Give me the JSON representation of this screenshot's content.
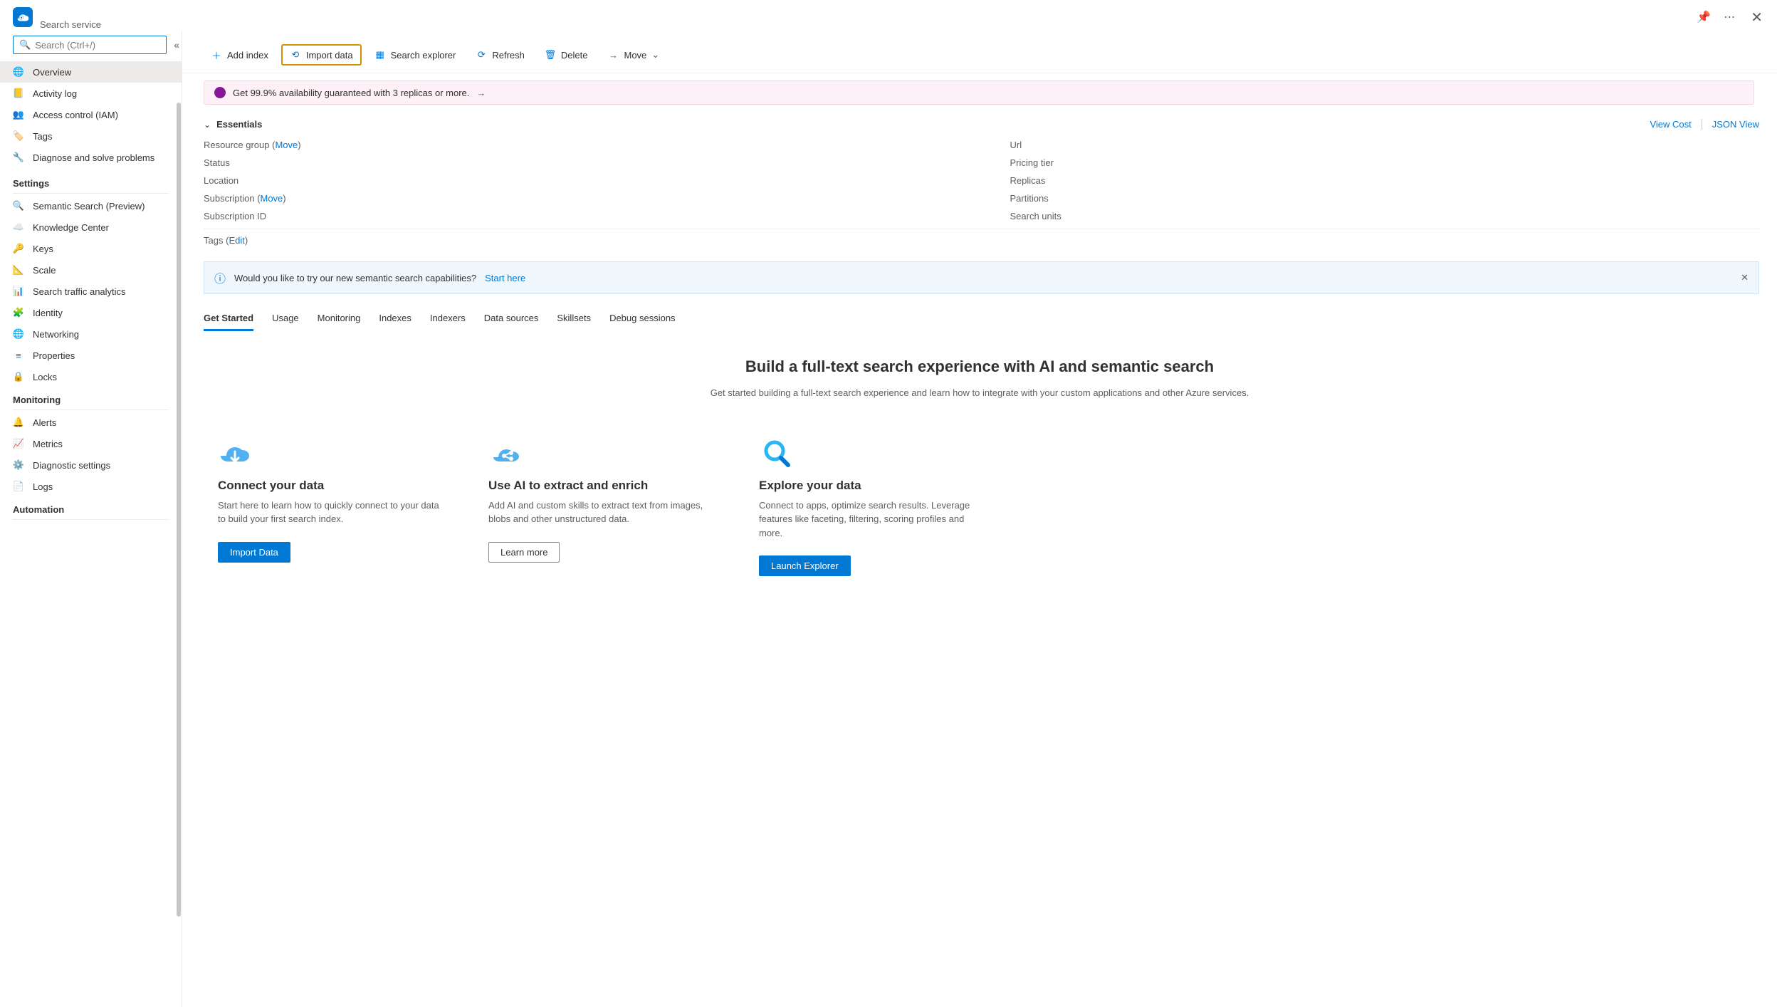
{
  "header": {
    "subtitle": "Search service",
    "pin_tooltip": "Pin",
    "more_tooltip": "More"
  },
  "sidebar": {
    "search_placeholder": "Search (Ctrl+/)",
    "top_items": [
      {
        "label": "Overview",
        "icon": "globe"
      },
      {
        "label": "Activity log",
        "icon": "log"
      },
      {
        "label": "Access control (IAM)",
        "icon": "people"
      },
      {
        "label": "Tags",
        "icon": "tag"
      },
      {
        "label": "Diagnose and solve problems",
        "icon": "wrench"
      }
    ],
    "sections": [
      {
        "title": "Settings",
        "items": [
          {
            "label": "Semantic Search (Preview)",
            "icon": "search"
          },
          {
            "label": "Knowledge Center",
            "icon": "cloud"
          },
          {
            "label": "Keys",
            "icon": "key"
          },
          {
            "label": "Scale",
            "icon": "scale"
          },
          {
            "label": "Search traffic analytics",
            "icon": "chart"
          },
          {
            "label": "Identity",
            "icon": "identity"
          },
          {
            "label": "Networking",
            "icon": "network"
          },
          {
            "label": "Properties",
            "icon": "properties"
          },
          {
            "label": "Locks",
            "icon": "lock"
          }
        ]
      },
      {
        "title": "Monitoring",
        "items": [
          {
            "label": "Alerts",
            "icon": "alert"
          },
          {
            "label": "Metrics",
            "icon": "metrics"
          },
          {
            "label": "Diagnostic settings",
            "icon": "diag"
          },
          {
            "label": "Logs",
            "icon": "logs"
          }
        ]
      },
      {
        "title": "Automation",
        "items": []
      }
    ]
  },
  "toolbar": {
    "items": [
      {
        "label": "Add index",
        "icon": "plus"
      },
      {
        "label": "Import data",
        "icon": "import",
        "highlight": true
      },
      {
        "label": "Search explorer",
        "icon": "grid"
      },
      {
        "label": "Refresh",
        "icon": "refresh"
      },
      {
        "label": "Delete",
        "icon": "delete"
      },
      {
        "label": "Move",
        "icon": "move",
        "dropdown": true
      }
    ]
  },
  "banner": {
    "text": "Get 99.9% availability guaranteed with 3 replicas or more."
  },
  "essentials": {
    "title": "Essentials",
    "view_cost": "View Cost",
    "json_view": "JSON View",
    "left": [
      {
        "label": "Resource group",
        "link": "Move"
      },
      {
        "label": "Status"
      },
      {
        "label": "Location"
      },
      {
        "label": "Subscription",
        "link": "Move"
      },
      {
        "label": "Subscription ID"
      }
    ],
    "right": [
      {
        "label": "Url"
      },
      {
        "label": "Pricing tier"
      },
      {
        "label": "Replicas"
      },
      {
        "label": "Partitions"
      },
      {
        "label": "Search units"
      }
    ],
    "tags_label": "Tags",
    "tags_edit": "Edit"
  },
  "info": {
    "text": "Would you like to try our new semantic search capabilities?",
    "link": "Start here"
  },
  "tabs": [
    "Get Started",
    "Usage",
    "Monitoring",
    "Indexes",
    "Indexers",
    "Data sources",
    "Skillsets",
    "Debug sessions"
  ],
  "hero": {
    "title": "Build a full-text search experience with AI and semantic search",
    "subtitle": "Get started building a full-text search experience and learn how to integrate with your custom applications and other Azure services."
  },
  "cards": [
    {
      "title": "Connect your data",
      "body": "Start here to learn how to quickly connect to your data to build your first search index.",
      "button": "Import Data",
      "btn_style": "primary"
    },
    {
      "title": "Use AI to extract and enrich",
      "body": "Add AI and custom skills to extract text from images, blobs and other unstructured data.",
      "button": "Learn more",
      "btn_style": "secondary"
    },
    {
      "title": "Explore your data",
      "body": "Connect to apps, optimize search results. Leverage features like faceting, filtering, scoring profiles and more.",
      "button": "Launch Explorer",
      "btn_style": "primary"
    }
  ]
}
